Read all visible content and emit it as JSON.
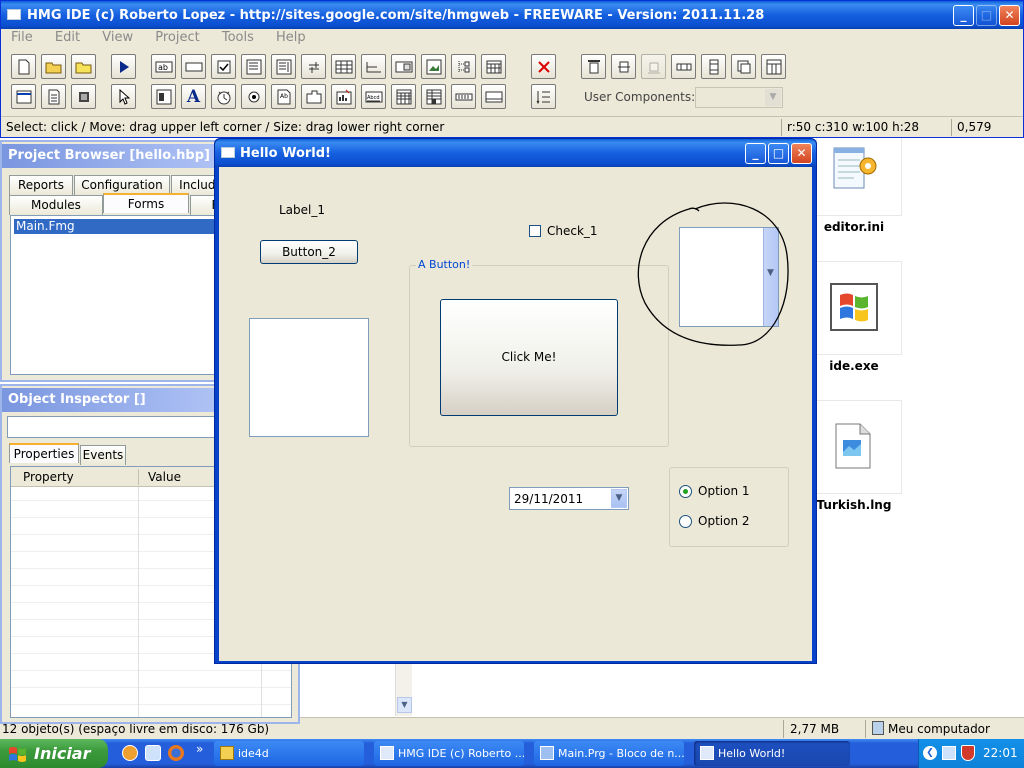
{
  "ide": {
    "title": "HMG IDE (c) Roberto Lopez - http://sites.google.com/site/hmgweb - FREEWARE - Version: 2011.11.28",
    "menu": [
      "File",
      "Edit",
      "View",
      "Project",
      "Tools",
      "Help"
    ],
    "status_hint": "Select: click / Move: drag upper left corner / Size: drag lower right corner",
    "status_geometry": "r:50 c:310 w:100 h:28",
    "status_coords": "0,579",
    "user_components_label": "User Components:",
    "user_components_value": ""
  },
  "project_browser": {
    "title": "Project Browser [hello.hbp]",
    "tabs_row1": [
      "Reports",
      "Configuration",
      "Include"
    ],
    "tabs_row2": [
      "Modules",
      "Forms",
      "F"
    ],
    "active_tab": "Forms",
    "items": [
      "Main.Fmg"
    ]
  },
  "object_inspector": {
    "title": "Object Inspector []",
    "combo_value": "",
    "tabs": [
      "Properties",
      "Events"
    ],
    "columns": [
      "Property",
      "Value"
    ]
  },
  "form": {
    "title": "Hello World!",
    "label1": "Label_1",
    "button2": "Button_2",
    "check1": "Check_1",
    "frame_caption": "A Button!",
    "click_button": "Click Me!",
    "date_value": "29/11/2011",
    "option1": "Option 1",
    "option2": "Option 2",
    "selected_option": "Option 1"
  },
  "desktop": {
    "icons": [
      {
        "label": "editor.ini",
        "icon": "notepad-settings-icon"
      },
      {
        "label": "ide.exe",
        "icon": "windows-logo-icon"
      },
      {
        "label": "Turkish.lng",
        "icon": "generic-file-icon"
      }
    ]
  },
  "explorer_status": {
    "left": "12 objeto(s) (espaço livre em disco: 176 Gb)",
    "size": "2,77 MB",
    "location": "Meu computador"
  },
  "taskbar": {
    "start": "Iniciar",
    "overflow": "»",
    "buttons": [
      {
        "label": "ide4d",
        "icon": "folder-icon"
      },
      {
        "label": "HMG IDE (c) Roberto ...",
        "icon": "window-icon"
      },
      {
        "label": "Main.Prg - Bloco de n...",
        "icon": "notepad-icon"
      },
      {
        "label": "Hello World!",
        "icon": "window-icon"
      }
    ],
    "clock": "22:01"
  },
  "colors": {
    "xp_blue": "#0a5fd8",
    "window_face": "#ece9d8",
    "form_face": "#ebe8d7",
    "taskbar_green": "#3c9a3c",
    "selection": "#316ac5",
    "frame_caption": "#0046d5"
  }
}
